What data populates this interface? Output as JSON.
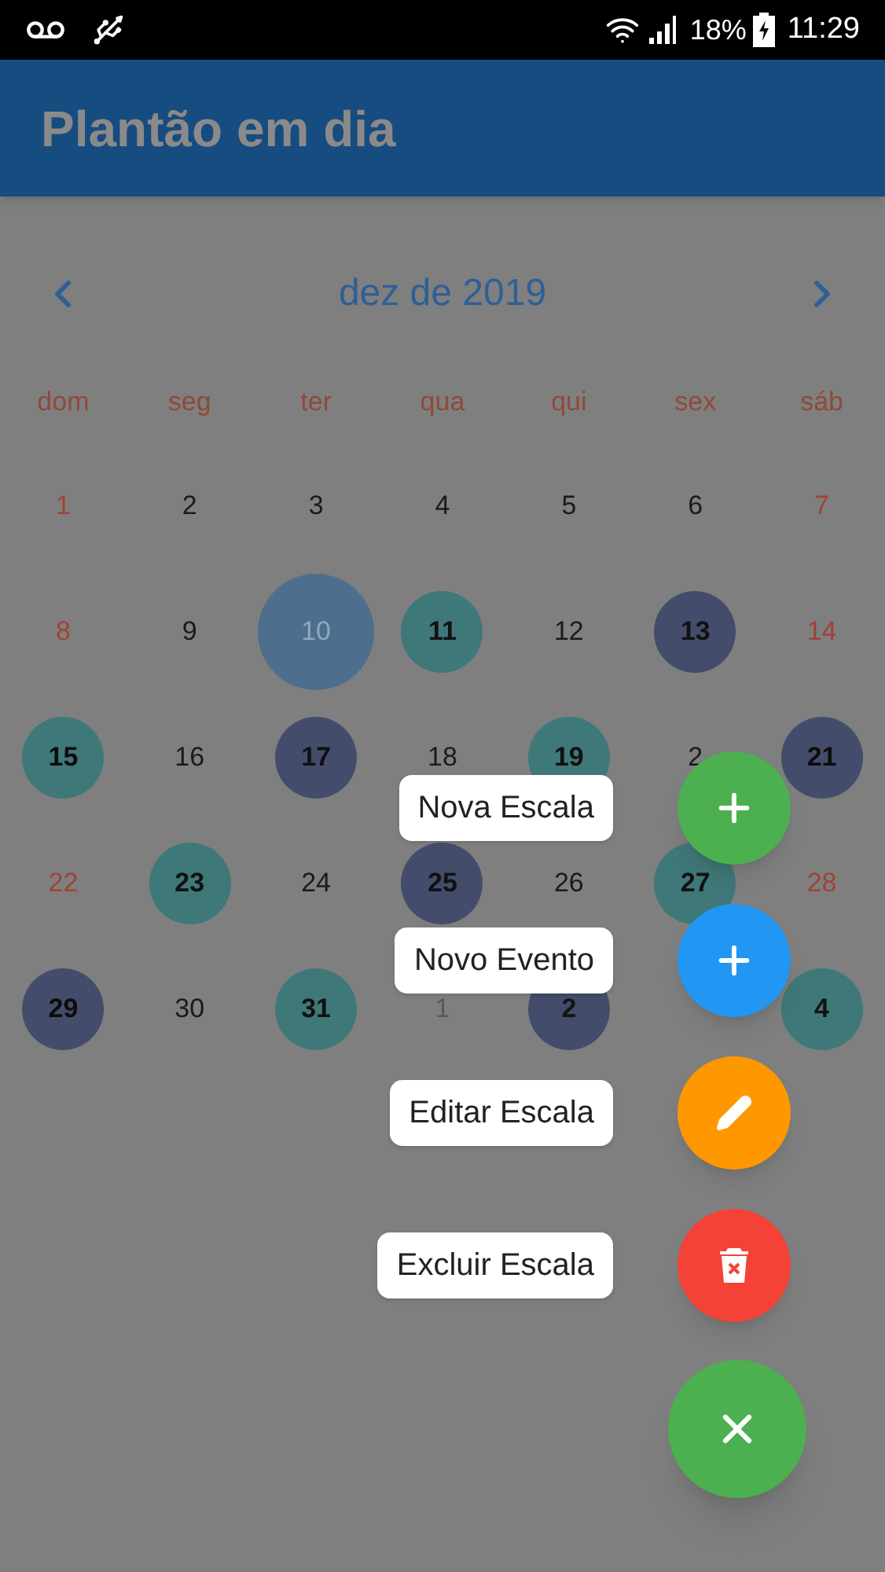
{
  "status_bar": {
    "battery": "18%",
    "time": "11:29"
  },
  "app_bar": {
    "title": "Plantão em dia"
  },
  "calendar": {
    "month": "dez de 2019",
    "weekdays": [
      {
        "label": "dom"
      },
      {
        "label": "seg"
      },
      {
        "label": "ter"
      },
      {
        "label": "qua"
      },
      {
        "label": "qui"
      },
      {
        "label": "sex"
      },
      {
        "label": "sáb"
      }
    ],
    "days": [
      {
        "label": "1",
        "kind": "weekend",
        "selected": false
      },
      {
        "label": "2",
        "kind": "weekday",
        "selected": false
      },
      {
        "label": "3",
        "kind": "weekday",
        "selected": false
      },
      {
        "label": "4",
        "kind": "weekday",
        "selected": false
      },
      {
        "label": "5",
        "kind": "weekday",
        "selected": false
      },
      {
        "label": "6",
        "kind": "weekday",
        "selected": false
      },
      {
        "label": "7",
        "kind": "weekend",
        "selected": false
      },
      {
        "label": "8",
        "kind": "weekend",
        "selected": false
      },
      {
        "label": "9",
        "kind": "weekday",
        "selected": false
      },
      {
        "label": "10",
        "kind": "weekday",
        "selected": true
      },
      {
        "label": "11",
        "kind": "weekday",
        "selected": false,
        "color": "#3f7878"
      },
      {
        "label": "12",
        "kind": "weekday",
        "selected": false
      },
      {
        "label": "13",
        "kind": "weekday",
        "selected": false,
        "color": "#434d6b"
      },
      {
        "label": "14",
        "kind": "weekend",
        "selected": false
      },
      {
        "label": "15",
        "kind": "weekend",
        "selected": false,
        "color": "#3f7878"
      },
      {
        "label": "16",
        "kind": "weekday",
        "selected": false
      },
      {
        "label": "17",
        "kind": "weekday",
        "selected": false,
        "color": "#434d6b"
      },
      {
        "label": "18",
        "kind": "weekday",
        "selected": false
      },
      {
        "label": "19",
        "kind": "weekday",
        "selected": false,
        "color": "#3f7878"
      },
      {
        "label": "2",
        "kind": "weekday",
        "selected": false
      },
      {
        "label": "21",
        "kind": "weekend",
        "selected": false,
        "color": "#434d6b"
      },
      {
        "label": "22",
        "kind": "weekend",
        "selected": false
      },
      {
        "label": "23",
        "kind": "weekday",
        "selected": false,
        "color": "#3f7878"
      },
      {
        "label": "24",
        "kind": "weekday",
        "selected": false
      },
      {
        "label": "25",
        "kind": "weekday",
        "selected": false,
        "color": "#434d6b"
      },
      {
        "label": "26",
        "kind": "weekday",
        "selected": false
      },
      {
        "label": "27",
        "kind": "weekday",
        "selected": false,
        "color": "#3f7878"
      },
      {
        "label": "28",
        "kind": "weekend",
        "selected": false
      },
      {
        "label": "29",
        "kind": "weekend",
        "selected": false,
        "color": "#434d6b"
      },
      {
        "label": "30",
        "kind": "weekday",
        "selected": false
      },
      {
        "label": "31",
        "kind": "weekday",
        "selected": false,
        "color": "#3f7878"
      },
      {
        "label": "1",
        "kind": "other_month",
        "selected": false
      },
      {
        "label": "2",
        "kind": "other_month",
        "selected": false,
        "color": "#434d6b"
      },
      {
        "kind": "other_month"
      },
      {
        "label": "4",
        "kind": "other_month",
        "selected": false,
        "color": "#3f7878"
      }
    ]
  },
  "fab_menu": {
    "actions": [
      {
        "label": "Nova Escala",
        "kind": "add",
        "color": "#4caf50"
      },
      {
        "label": "Novo Evento",
        "kind": "add",
        "color": "#2196f3"
      },
      {
        "label": "Editar Escala",
        "kind": "edit",
        "color": "#ff9800"
      },
      {
        "label": "Excluir Escala",
        "kind": "delete",
        "color": "#f44336"
      }
    ],
    "main": {
      "color": "#4caf50"
    }
  }
}
